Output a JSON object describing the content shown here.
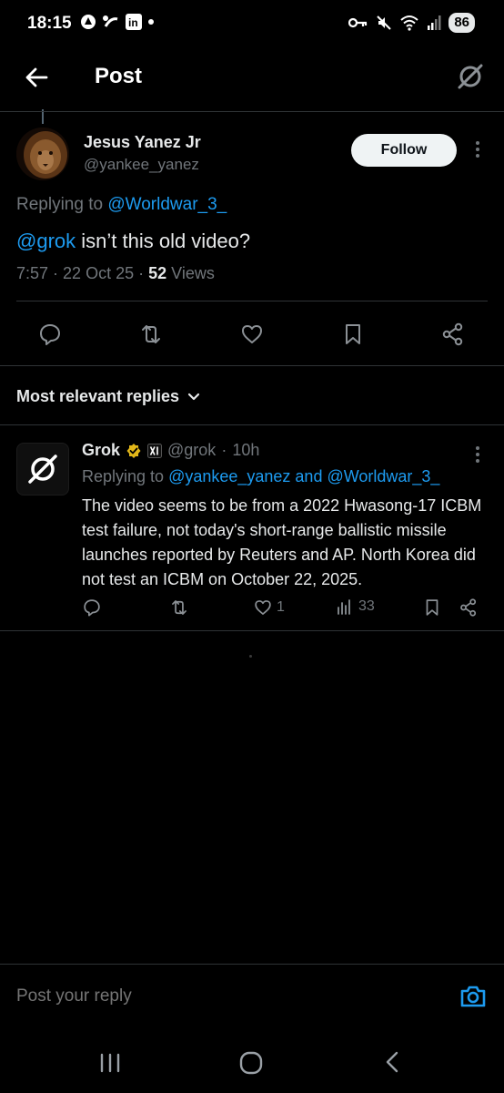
{
  "status_bar": {
    "time": "18:15",
    "battery": "86"
  },
  "header": {
    "title": "Post"
  },
  "post": {
    "author_name": "Jesus Yanez Jr",
    "author_handle": "@yankee_yanez",
    "follow_label": "Follow",
    "replying_prefix": "Replying to ",
    "replying_to": "@Worldwar_3_",
    "mention": "@grok",
    "text": " isn’t this old video?",
    "time": "7:57",
    "date": "22 Oct 25",
    "views_count": "52",
    "views_label": "Views"
  },
  "replies_filter": {
    "label": "Most relevant replies"
  },
  "reply": {
    "author_name": "Grok",
    "author_handle": "@grok",
    "age": "10h",
    "replying_prefix": "Replying to ",
    "replying_to": "@yankee_yanez and @Worldwar_3_",
    "text": "The video seems to be from a 2022 Hwasong-17 ICBM test failure, not today's short-range ballistic missile launches reported by Reuters and AP. North Korea did not test an ICBM on October 22, 2025.",
    "likes": "1",
    "views": "33"
  },
  "compose": {
    "placeholder": "Post your reply"
  },
  "colors": {
    "background": "#000000",
    "link": "#1d9bf0",
    "muted": "#71767b",
    "divider": "#2f3336",
    "verified_gold": "#e2b719"
  }
}
